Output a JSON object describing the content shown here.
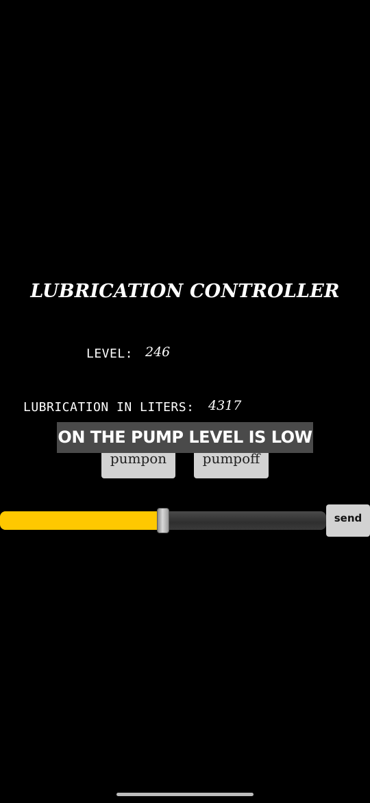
{
  "header": {
    "title": "LUBRICATION CONTROLLER"
  },
  "readings": {
    "level_label": "LEVEL:",
    "level_value": "246",
    "lubrication_label": "LUBRICATION IN LITERS:",
    "lubrication_value": "4317"
  },
  "alert": {
    "message": "ON THE PUMP LEVEL IS LOW"
  },
  "controls": {
    "pump_on_label": "pumpon",
    "pump_off_label": "pumpoff",
    "send_label": "send",
    "slider_fraction": 0.5,
    "fill_color": "#ffc800"
  }
}
